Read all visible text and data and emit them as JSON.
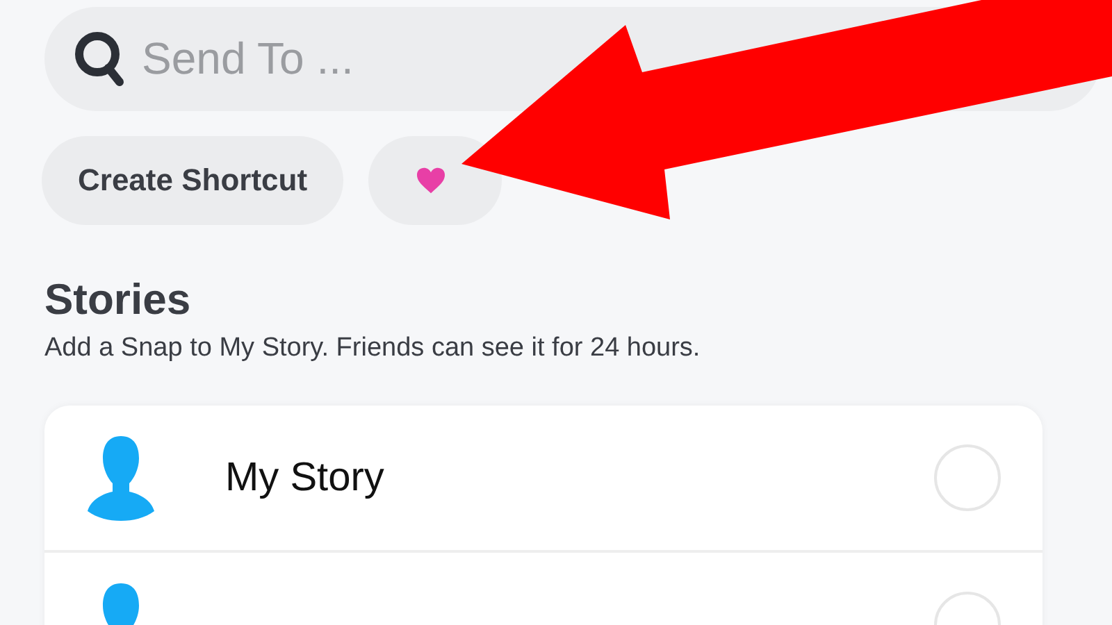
{
  "search": {
    "placeholder": "Send To ..."
  },
  "chips": [
    {
      "kind": "text",
      "label": "Create Shortcut"
    },
    {
      "kind": "heart"
    }
  ],
  "stories": {
    "title": "Stories",
    "subtitle": "Add a Snap to My Story. Friends can see it for 24 hours.",
    "items": [
      {
        "name": "My Story",
        "selected": false
      },
      {
        "selected": false
      }
    ]
  }
}
